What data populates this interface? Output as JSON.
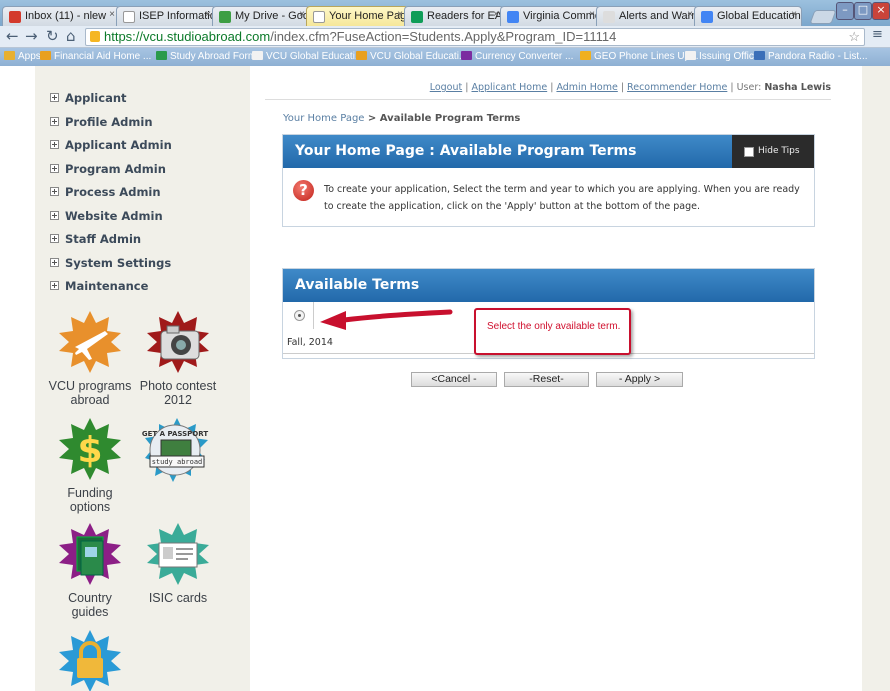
{
  "browser": {
    "tabs": [
      {
        "label": "Inbox (11) - nlew",
        "color": "#d33a2c",
        "active": false
      },
      {
        "label": "ISEP Information",
        "color": "#ffffff",
        "active": false
      },
      {
        "label": "My Drive - Goog",
        "color": "#3d9e44",
        "active": false
      },
      {
        "label": "Your Home Page",
        "color": "#ffffff",
        "active": true
      },
      {
        "label": "Readers for EA S",
        "color": "#0f9d58",
        "active": false
      },
      {
        "label": "Virginia Commo",
        "color": "#4285f4",
        "active": false
      },
      {
        "label": "Alerts and Warni",
        "color": "#dddddd",
        "active": false
      },
      {
        "label": "Global Education",
        "color": "#4285f4",
        "active": false
      }
    ],
    "url_host": "https://vcu.studioabroad.com",
    "url_path": "/index.cfm?FuseAction=Students.Apply&Program_ID=11114",
    "bookmarks": [
      {
        "label": "Apps",
        "color": "#e8b030"
      },
      {
        "label": "Financial Aid Home ...",
        "color": "#e8a020"
      },
      {
        "label": "Study Abroad Form",
        "color": "#2a9a4a"
      },
      {
        "label": "VCU Global Educati...",
        "color": "#f2f2f2"
      },
      {
        "label": "VCU Global Educati...",
        "color": "#e8a020"
      },
      {
        "label": "Currency Converter ...",
        "color": "#7b2da0"
      },
      {
        "label": "GEO Phone Lines Up...",
        "color": "#f0b020"
      },
      {
        "label": "Issuing Offices",
        "color": "#f2f2f2"
      },
      {
        "label": "Pandora Radio - List...",
        "color": "#3a6fb8"
      }
    ]
  },
  "sidebar": {
    "menu": [
      "Applicant",
      "Profile Admin",
      "Applicant Admin",
      "Program Admin",
      "Process Admin",
      "Website Admin",
      "Staff Admin",
      "System Settings",
      "Maintenance"
    ],
    "promos": [
      {
        "line1": "VCU programs",
        "line2": "abroad",
        "icon": "airplane-icon",
        "color": "#e8902c"
      },
      {
        "line1": "Photo contest",
        "line2": "2012",
        "icon": "camera-icon",
        "color": "#a01a1a"
      },
      {
        "line1": "Funding",
        "line2": "options",
        "icon": "dollar-icon",
        "color": "#2f8a2f"
      },
      {
        "line1": "",
        "line2": "",
        "icon": "passport-icon",
        "color": "#2a9ac8",
        "stamp_top": "GET A PASSPORT",
        "stamp_mid": "study abroad"
      },
      {
        "line1": "Country",
        "line2": "guides",
        "icon": "book-icon",
        "color": "#8c1f86"
      },
      {
        "line1": "ISIC cards",
        "line2": "",
        "icon": "id-card-icon",
        "color": "#3aab98"
      },
      {
        "line1": "",
        "line2": "",
        "icon": "lock-icon",
        "color": "#2a9ad6"
      }
    ]
  },
  "header": {
    "links": [
      "Logout",
      "Applicant Home",
      "Admin Home",
      "Recommender Home"
    ],
    "user_label": "User:",
    "user_name": "Nasha Lewis"
  },
  "breadcrumb": {
    "home": "Your Home Page",
    "separator": " > ",
    "current": "Available Program Terms"
  },
  "main": {
    "title": "Your Home Page : Available Program Terms",
    "hide_tips": "Hide Tips",
    "tip_icon": "?",
    "tip_text": "To create your application, Select the term and year to which you are applying. When you are ready to create the application, click on the 'Apply' button at the bottom of the page.",
    "terms_title": "Available Terms",
    "terms": [
      {
        "label": "Fall, 2014",
        "selected": true
      }
    ],
    "annotation": "Select the only available term.",
    "buttons": {
      "cancel": "<Cancel -",
      "reset": "-Reset-",
      "apply": "- Apply >"
    }
  },
  "colors": {
    "panel_header": "#2c73b4",
    "annotation": "#d0102e"
  }
}
